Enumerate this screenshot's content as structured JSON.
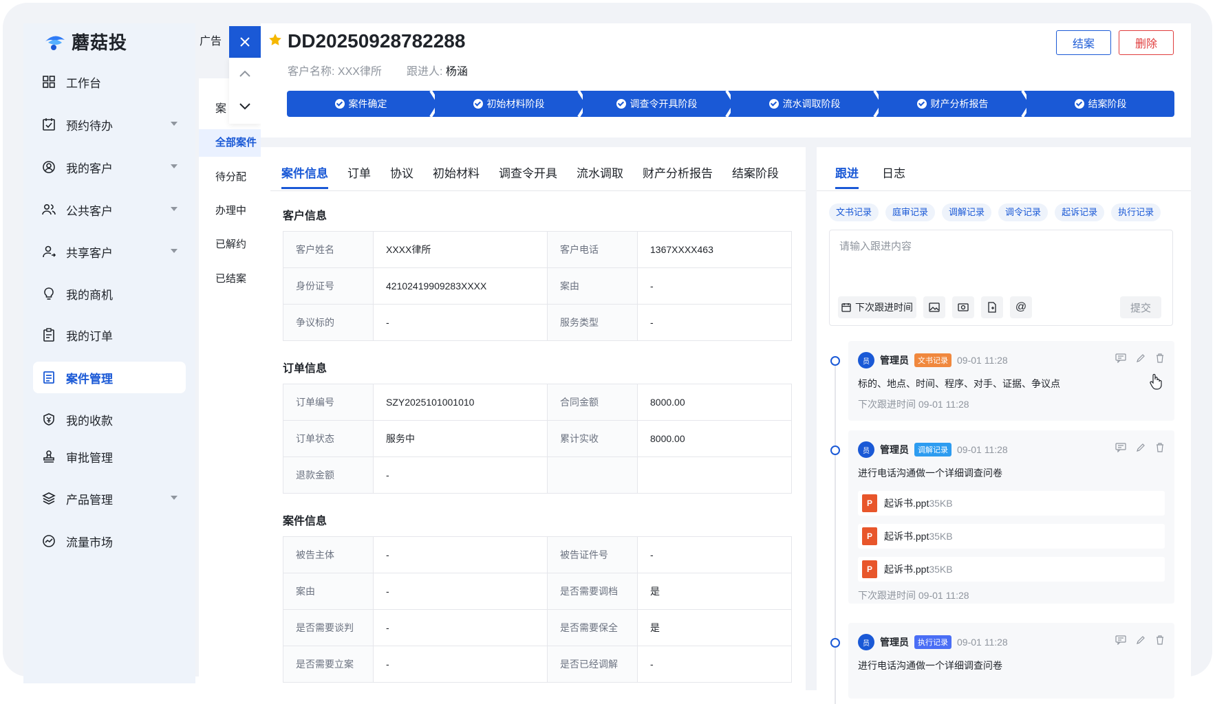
{
  "app": {
    "name": "蘑菇投",
    "ad_label": "广告"
  },
  "sidebar": {
    "items": [
      {
        "label": "工作台",
        "icon": "grid-icon",
        "has_arrow": false
      },
      {
        "label": "预约待办",
        "icon": "calendar-icon",
        "has_arrow": true
      },
      {
        "label": "我的客户",
        "icon": "user-circle-icon",
        "has_arrow": true
      },
      {
        "label": "公共客户",
        "icon": "users-icon",
        "has_arrow": true
      },
      {
        "label": "共享客户",
        "icon": "user-share-icon",
        "has_arrow": true
      },
      {
        "label": "我的商机",
        "icon": "bulb-icon",
        "has_arrow": false
      },
      {
        "label": "我的订单",
        "icon": "clipboard-icon",
        "has_arrow": false
      },
      {
        "label": "案件管理",
        "icon": "document-icon",
        "has_arrow": false,
        "active": true
      },
      {
        "label": "我的收款",
        "icon": "shield-money-icon",
        "has_arrow": false
      },
      {
        "label": "审批管理",
        "icon": "stamp-icon",
        "has_arrow": false
      },
      {
        "label": "产品管理",
        "icon": "layers-icon",
        "has_arrow": true
      },
      {
        "label": "流量市场",
        "icon": "chart-circle-icon",
        "has_arrow": false
      }
    ]
  },
  "subpanel": {
    "header": "案",
    "items": [
      "全部案件",
      "待分配",
      "办理中",
      "已解约",
      "已结案"
    ]
  },
  "header": {
    "title": "DD20250928782288",
    "customer_label": "客户名称:",
    "customer_value": "XXX律所",
    "follower_label": "跟进人:",
    "follower_value": "杨涵",
    "close_case_button": "结案",
    "delete_button": "删除"
  },
  "stages": [
    "案件确定",
    "初始材料阶段",
    "调查令开具阶段",
    "流水调取阶段",
    "财产分析报告",
    "结案阶段"
  ],
  "detail_tabs": [
    "案件信息",
    "订单",
    "协议",
    "初始材料",
    "调查令开具",
    "流水调取",
    "财产分析报告",
    "结案阶段"
  ],
  "customer_info": {
    "title": "客户信息",
    "rows": [
      [
        "客户姓名",
        "XXXX律所",
        "客户电话",
        "1367XXXX463"
      ],
      [
        "身份证号",
        "42102419909283XXXX",
        "案由",
        "-"
      ],
      [
        "争议标的",
        "-",
        "服务类型",
        "-"
      ]
    ]
  },
  "order_info": {
    "title": "订单信息",
    "rows": [
      [
        "订单编号",
        "SZY2025101001010",
        "合同金额",
        "8000.00"
      ],
      [
        "订单状态",
        "服务中",
        "累计实收",
        "8000.00"
      ],
      [
        "退款金额",
        "-",
        "",
        ""
      ]
    ]
  },
  "case_info": {
    "title": "案件信息",
    "rows": [
      [
        "被告主体",
        "-",
        "被告证件号",
        "-"
      ],
      [
        "案由",
        "-",
        "是否需要调档",
        "是"
      ],
      [
        "是否需要谈判",
        "-",
        "是否需要保全",
        "是"
      ],
      [
        "是否需要立案",
        "-",
        "是否已经调解",
        "-"
      ]
    ]
  },
  "follow": {
    "tabs": [
      "跟进",
      "日志"
    ],
    "chips": [
      "文书记录",
      "庭审记录",
      "调解记录",
      "调令记录",
      "起诉记录",
      "执行记录"
    ],
    "placeholder": "请输入跟进内容",
    "next_time_button": "下次跟进时间",
    "submit_button": "提交",
    "entries": [
      {
        "avatar": "员",
        "user": "管理员",
        "tag": "文书记录",
        "tag_color": "#f0883e",
        "time": "09-01 11:28",
        "text": "标的、地点、时间、程序、对手、证据、争议点",
        "next": "下次跟进时间 09-01 11:28",
        "files": []
      },
      {
        "avatar": "员",
        "user": "管理员",
        "tag": "调解记录",
        "tag_color": "#2d9cf0",
        "time": "09-01 11:28",
        "text": "进行电话沟通做一个详细调查问卷",
        "next": "下次跟进时间 09-01 11:28",
        "files": [
          {
            "name": "起诉书.ppt",
            "size": "35KB"
          },
          {
            "name": "起诉书.ppt",
            "size": "35KB"
          },
          {
            "name": "起诉书.ppt",
            "size": "35KB"
          }
        ]
      },
      {
        "avatar": "员",
        "user": "管理员",
        "tag": "执行记录",
        "tag_color": "#4a6ef5",
        "time": "09-01 11:28",
        "text": "进行电话沟通做一个详细调查问卷",
        "next": "",
        "files": []
      }
    ]
  },
  "colors": {
    "primary": "#1a59d6",
    "danger": "#e03c3c"
  }
}
